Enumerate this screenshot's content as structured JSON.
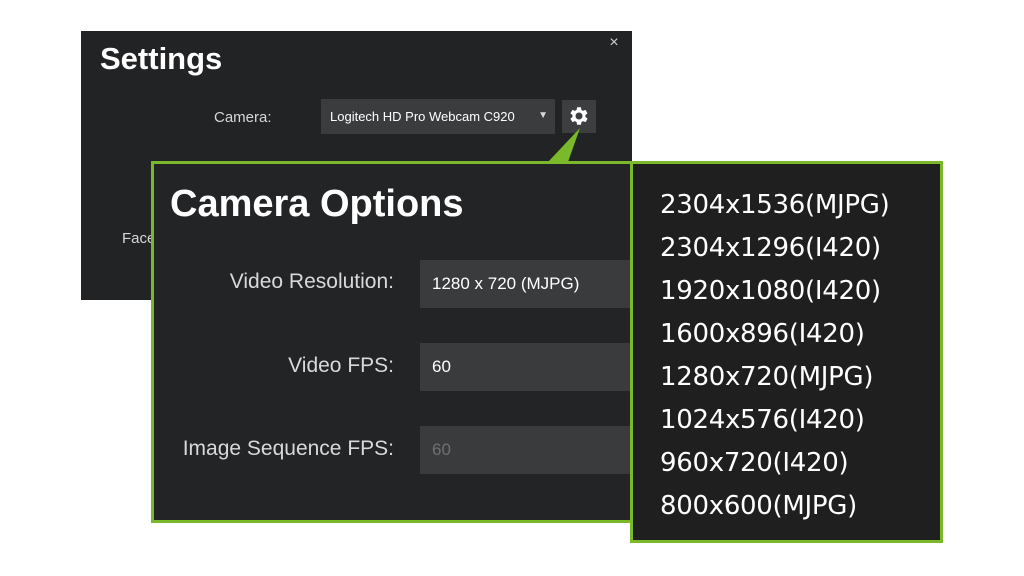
{
  "settings": {
    "title": "Settings",
    "close_label": "×",
    "camera_label": "Camera:",
    "camera_value": "Logitech HD Pro Webcam C920",
    "face_label": "Face"
  },
  "camera_options": {
    "title": "Camera Options",
    "video_resolution_label": "Video Resolution:",
    "video_resolution_value": "1280 x 720 (MJPG)",
    "video_fps_label": "Video FPS:",
    "video_fps_value": "60",
    "image_sequence_fps_label": "Image Sequence FPS:",
    "image_sequence_fps_value": "60"
  },
  "resolution_options": [
    "2304x1536(MJPG)",
    "2304x1296(I420)",
    "1920x1080(I420)",
    "1600x896(I420)",
    "1280x720(MJPG)",
    "1024x576(I420)",
    "960x720(I420)",
    "800x600(MJPG)"
  ],
  "colors": {
    "accent_green": "#7ab929",
    "panel_bg": "#232426",
    "field_bg": "#3a3b3d"
  }
}
